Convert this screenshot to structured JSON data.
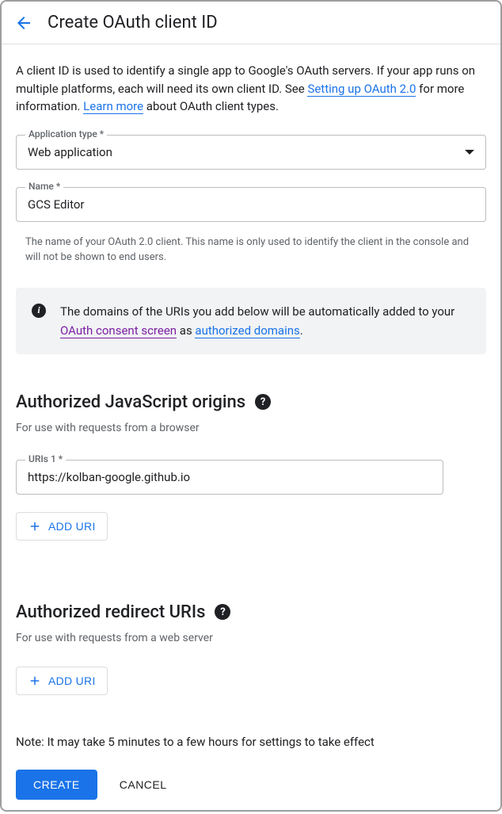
{
  "header": {
    "title": "Create OAuth client ID"
  },
  "intro": {
    "text1": "A client ID is used to identify a single app to Google's OAuth servers. If your app runs on multiple platforms, each will need its own client ID. See ",
    "link1": "Setting up OAuth 2.0",
    "text2": " for more information. ",
    "link2": "Learn more",
    "text3": " about OAuth client types."
  },
  "appType": {
    "label": "Application type *",
    "value": "Web application"
  },
  "name": {
    "label": "Name *",
    "value": "GCS Editor",
    "helper": "The name of your OAuth 2.0 client. This name is only used to identify the client in the console and will not be shown to end users."
  },
  "banner": {
    "text1": "The domains of the URIs you add below will be automatically added to your ",
    "link1": "OAuth consent screen",
    "text2": " as ",
    "link2": "authorized domains",
    "text3": "."
  },
  "jsOrigins": {
    "title": "Authorized JavaScript origins",
    "sub": "For use with requests from a browser",
    "uri1Label": "URIs 1 *",
    "uri1Value": "https://kolban-google.github.io",
    "addBtn": "ADD URI"
  },
  "redirectUris": {
    "title": "Authorized redirect URIs",
    "sub": "For use with requests from a web server",
    "addBtn": "ADD URI"
  },
  "note": "Note: It may take 5 minutes to a few hours for settings to take effect",
  "footer": {
    "create": "CREATE",
    "cancel": "CANCEL"
  }
}
